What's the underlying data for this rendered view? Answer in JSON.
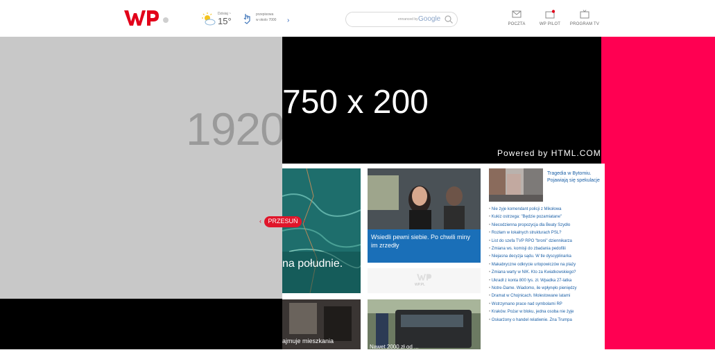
{
  "header": {
    "weather": {
      "day": "Dzisiaj ~",
      "temp": "15°"
    },
    "promo": {
      "line1": "przepisowa",
      "line2": "w okolo 7000"
    },
    "search": {
      "brand": "ennanced by",
      "engine": "Google"
    },
    "nav": [
      {
        "label": "POCZTA",
        "icon": "mail-icon"
      },
      {
        "label": "WP PILOT",
        "icon": "tv-pilot-icon"
      },
      {
        "label": "PROGRAM TV",
        "icon": "tv-icon"
      }
    ]
  },
  "ads": {
    "left_size": "1920",
    "top_size": "750 x 200",
    "top_powered": "Powered by HTML.COM",
    "colors": {
      "left": "#c8c8c8",
      "right": "#ff0052",
      "top": "#000000"
    }
  },
  "slider": {
    "label": "PRZESUŃ",
    "prev": "‹",
    "next": "›"
  },
  "tiles": {
    "map_caption": "na południe.",
    "car_caption": "Wsiedli pewni siebie. Po chwili miny im zrzedły",
    "wp_placeholder_label": "WP.PL",
    "room_caption": "ajmuje mieszkania",
    "suv_caption": "Nawet 2000 zł od ...",
    "thumb_caption": "Tragedia w Bytomiu. Pojawiają się spekulacje"
  },
  "news": [
    "Nie żyje komendant policji z Mikołowa",
    "Kukiz ostrzega: \"Będzie pozamiatane\"",
    "Niecodzienna propozycja dla Beaty Szydło",
    "Rozłam w lokalnych strukturach PSL?",
    "List do szefa TVP RPO \"broni\" dziennikarza",
    "Zmiana ws. komisji do zbadania pedofilii",
    "Niejasna decyzja sądu. W tle dyscyplinarka",
    "Makabryczne odkrycie urlopowiczów na plaży",
    "Zmiana warty w NIK. Kto za Kwiatkowskiego?",
    "Ukradł z konta 800 tys. zł. Wpadka 27-latka",
    "Notre-Dame. Wiadomo, ile wpłynęło pieniędzy",
    "Dramat w Chojnicach. Molestowane latami",
    "Wstrzymano prace nad symbolami RP",
    "Kraków. Pożar w bloku, jedna osoba nie żyje",
    "Oskarżony o handel relatiwnie. Zna Trumpa"
  ]
}
